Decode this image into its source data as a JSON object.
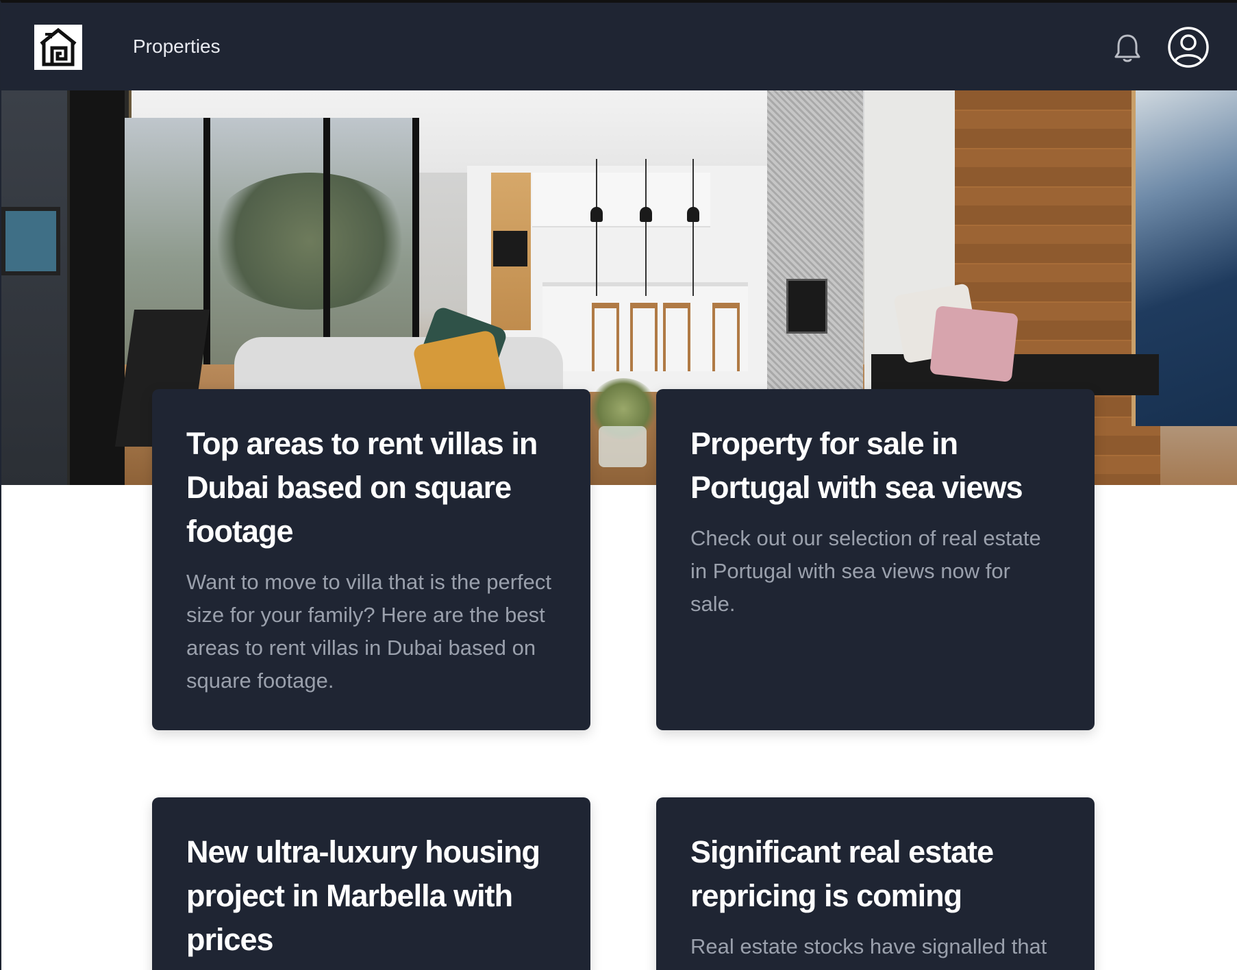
{
  "header": {
    "logo_icon": "house-logo-icon",
    "nav_link": "Properties",
    "notification_icon": "bell-icon",
    "account_icon": "user-circle-icon",
    "background_color": "#1f2533"
  },
  "hero": {
    "image_description_icon": "interior-living-kitchen-photo"
  },
  "cards": [
    {
      "title": "Top areas to rent villas in Dubai based on square footage",
      "description": "Want to move to villa that is the perfect size for your family? Here are the best areas to rent villas in Dubai based on square footage."
    },
    {
      "title": "Property for sale in Portugal with sea views",
      "description": "Check out our selection of real estate in Portugal with sea views now for sale."
    },
    {
      "title": "New ultra-luxury housing project in Marbella with prices",
      "description": ""
    },
    {
      "title": "Significant real estate repricing is coming",
      "description": "Real estate stocks have signalled that"
    }
  ],
  "colors": {
    "card_background": "#1f2533",
    "card_title": "#ffffff",
    "card_text": "#9aa0ac"
  }
}
